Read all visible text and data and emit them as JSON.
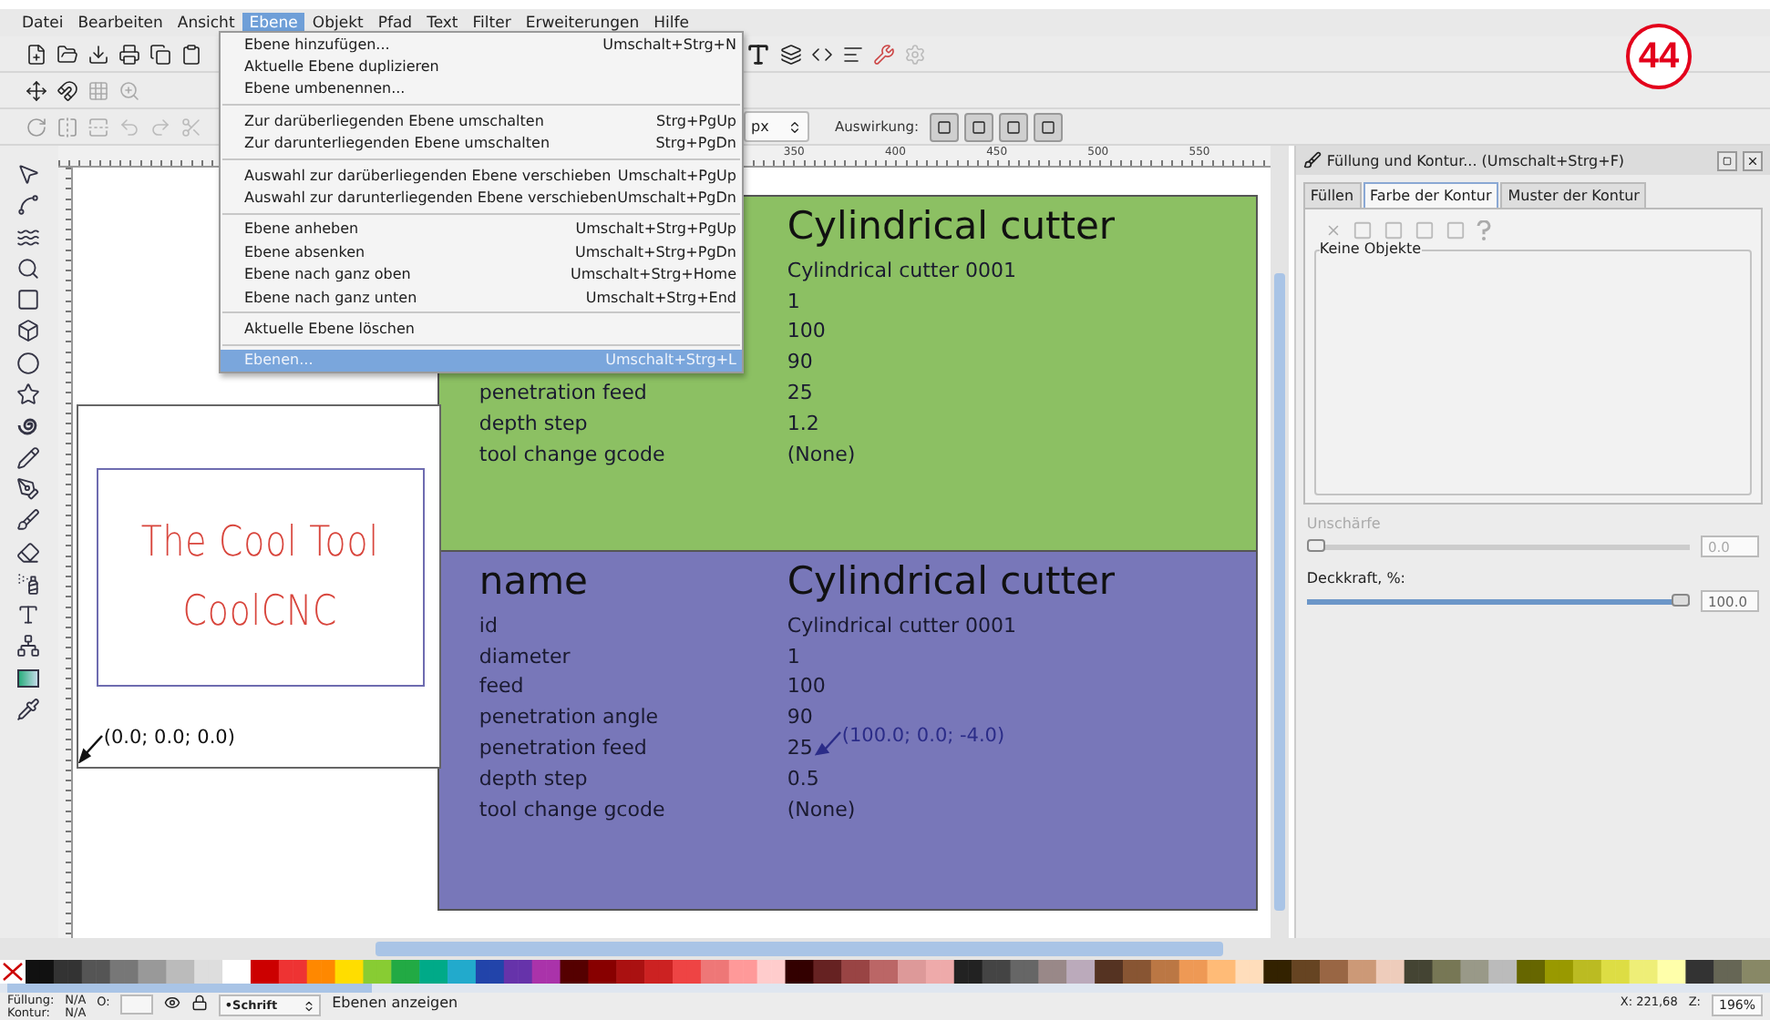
{
  "page_badge": "44",
  "menubar": [
    {
      "label": "Datei",
      "selected": false
    },
    {
      "label": "Bearbeiten",
      "selected": false
    },
    {
      "label": "Ansicht",
      "selected": false
    },
    {
      "label": "Ebene",
      "selected": true
    },
    {
      "label": "Objekt",
      "selected": false
    },
    {
      "label": "Pfad",
      "selected": false
    },
    {
      "label": "Text",
      "selected": false
    },
    {
      "label": "Filter",
      "selected": false
    },
    {
      "label": "Erweiterungen",
      "selected": false
    },
    {
      "label": "Hilfe",
      "selected": false
    }
  ],
  "layer_menu": {
    "groups": [
      [
        {
          "label": "Ebene hinzufügen...",
          "shortcut": "Umschalt+Strg+N",
          "selected": false
        },
        {
          "label": "Aktuelle Ebene duplizieren",
          "selected": false
        },
        {
          "label": "Ebene umbenennen...",
          "selected": false
        }
      ],
      [
        {
          "label": "Zur darüberliegenden Ebene umschalten",
          "shortcut": "Strg+PgUp",
          "selected": false
        },
        {
          "label": "Zur darunterliegenden Ebene umschalten",
          "shortcut": "Strg+PgDn",
          "selected": false
        }
      ],
      [
        {
          "label": "Auswahl zur darüberliegenden Ebene verschieben",
          "shortcut": "Umschalt+PgUp",
          "selected": false
        },
        {
          "label": "Auswahl zur darunterliegenden Ebene verschieben",
          "shortcut": "Umschalt+PgDn",
          "selected": false
        }
      ],
      [
        {
          "label": "Ebene anheben",
          "shortcut": "Umschalt+Strg+PgUp",
          "selected": false
        },
        {
          "label": "Ebene absenken",
          "shortcut": "Umschalt+Strg+PgDn",
          "selected": false
        },
        {
          "label": "Ebene nach ganz oben",
          "shortcut": "Umschalt+Strg+Home",
          "selected": false
        },
        {
          "label": "Ebene nach ganz unten",
          "shortcut": "Umschalt+Strg+End",
          "selected": false
        }
      ],
      [
        {
          "label": "Aktuelle Ebene löschen",
          "selected": false
        }
      ],
      [
        {
          "label": "Ebenen...",
          "shortcut": "Umschalt+Strg+L",
          "selected": true
        }
      ]
    ]
  },
  "tool_controls": {
    "unit": "px",
    "effect_label": "Auswirkung:"
  },
  "ruler": {
    "labels": [
      "350",
      "400",
      "450",
      "500",
      "550"
    ]
  },
  "cards": [
    {
      "color": "#8cc063",
      "title": "Cylindrical cutter",
      "rows": [
        {
          "value": "Cylindrical cutter 0001"
        },
        {
          "value": "1"
        },
        {
          "value": "100"
        },
        {
          "value": "90"
        },
        {
          "label": "penetration feed",
          "value": "25"
        },
        {
          "label": "depth step",
          "value": "1.2"
        },
        {
          "label": "tool change gcode",
          "value": "(None)"
        }
      ]
    },
    {
      "color": "#7877b9",
      "title_label": "name",
      "title": "Cylindrical cutter",
      "rows": [
        {
          "label": "id",
          "value": "Cylindrical cutter 0001"
        },
        {
          "label": "diameter",
          "value": "1"
        },
        {
          "label": "feed",
          "value": "100"
        },
        {
          "label": "penetration angle",
          "value": "90"
        },
        {
          "label": "penetration feed",
          "value": "25"
        },
        {
          "label": "depth step",
          "value": "0.5"
        },
        {
          "label": "tool change gcode",
          "value": "(None)"
        }
      ]
    }
  ],
  "label_card": {
    "lines": [
      "The Cool Tool",
      "CoolCNC"
    ],
    "origin": "(0.0; 0.0; 0.0)"
  },
  "end_point": "(100.0; 0.0; -4.0)",
  "dock": {
    "title": "Füllung und Kontur... (Umschalt+Strg+F)",
    "tabs": [
      {
        "label": "Füllen",
        "selected": false
      },
      {
        "label": "Farbe der Kontur",
        "selected": true
      },
      {
        "label": "Muster der Kontur",
        "selected": false
      }
    ],
    "frame_label": "Keine Objekte",
    "sliders": [
      {
        "label": "Unschärfe",
        "disabled": true,
        "level": 0,
        "value": "0.0"
      },
      {
        "label": "Deckkraft, %:",
        "disabled": false,
        "level": 1,
        "value": "100.0"
      }
    ]
  },
  "status": {
    "fill_label": "Füllung:",
    "fill_value": "N/A",
    "stroke_label": "Kontur:",
    "stroke_value": "N/A",
    "opacity_label": "O:",
    "layer": "•Schrift",
    "message": "Ebenen anzeigen",
    "x": "X: 221,68",
    "zoom_label": "Z:",
    "zoom": "196%"
  }
}
